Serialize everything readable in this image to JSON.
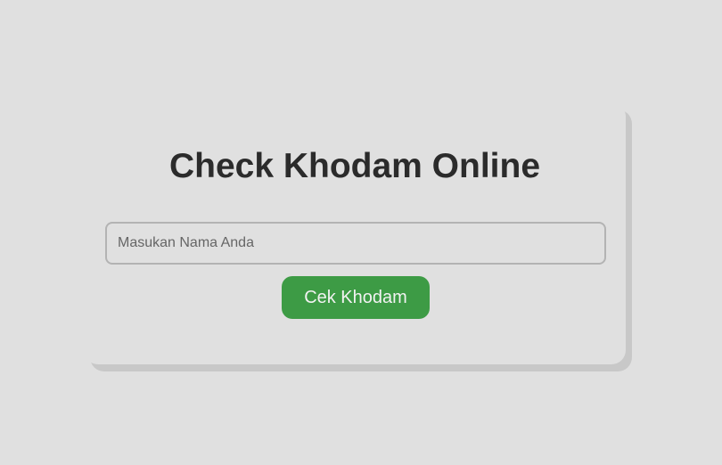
{
  "app": {
    "title": "Check Khodam Online"
  },
  "form": {
    "name_input": {
      "placeholder": "Masukan Nama Anda",
      "value": ""
    },
    "submit_label": "Cek Khodam"
  },
  "colors": {
    "background": "#e0e0e0",
    "button": "#3d9b45",
    "title_text": "#2b2b2b"
  }
}
